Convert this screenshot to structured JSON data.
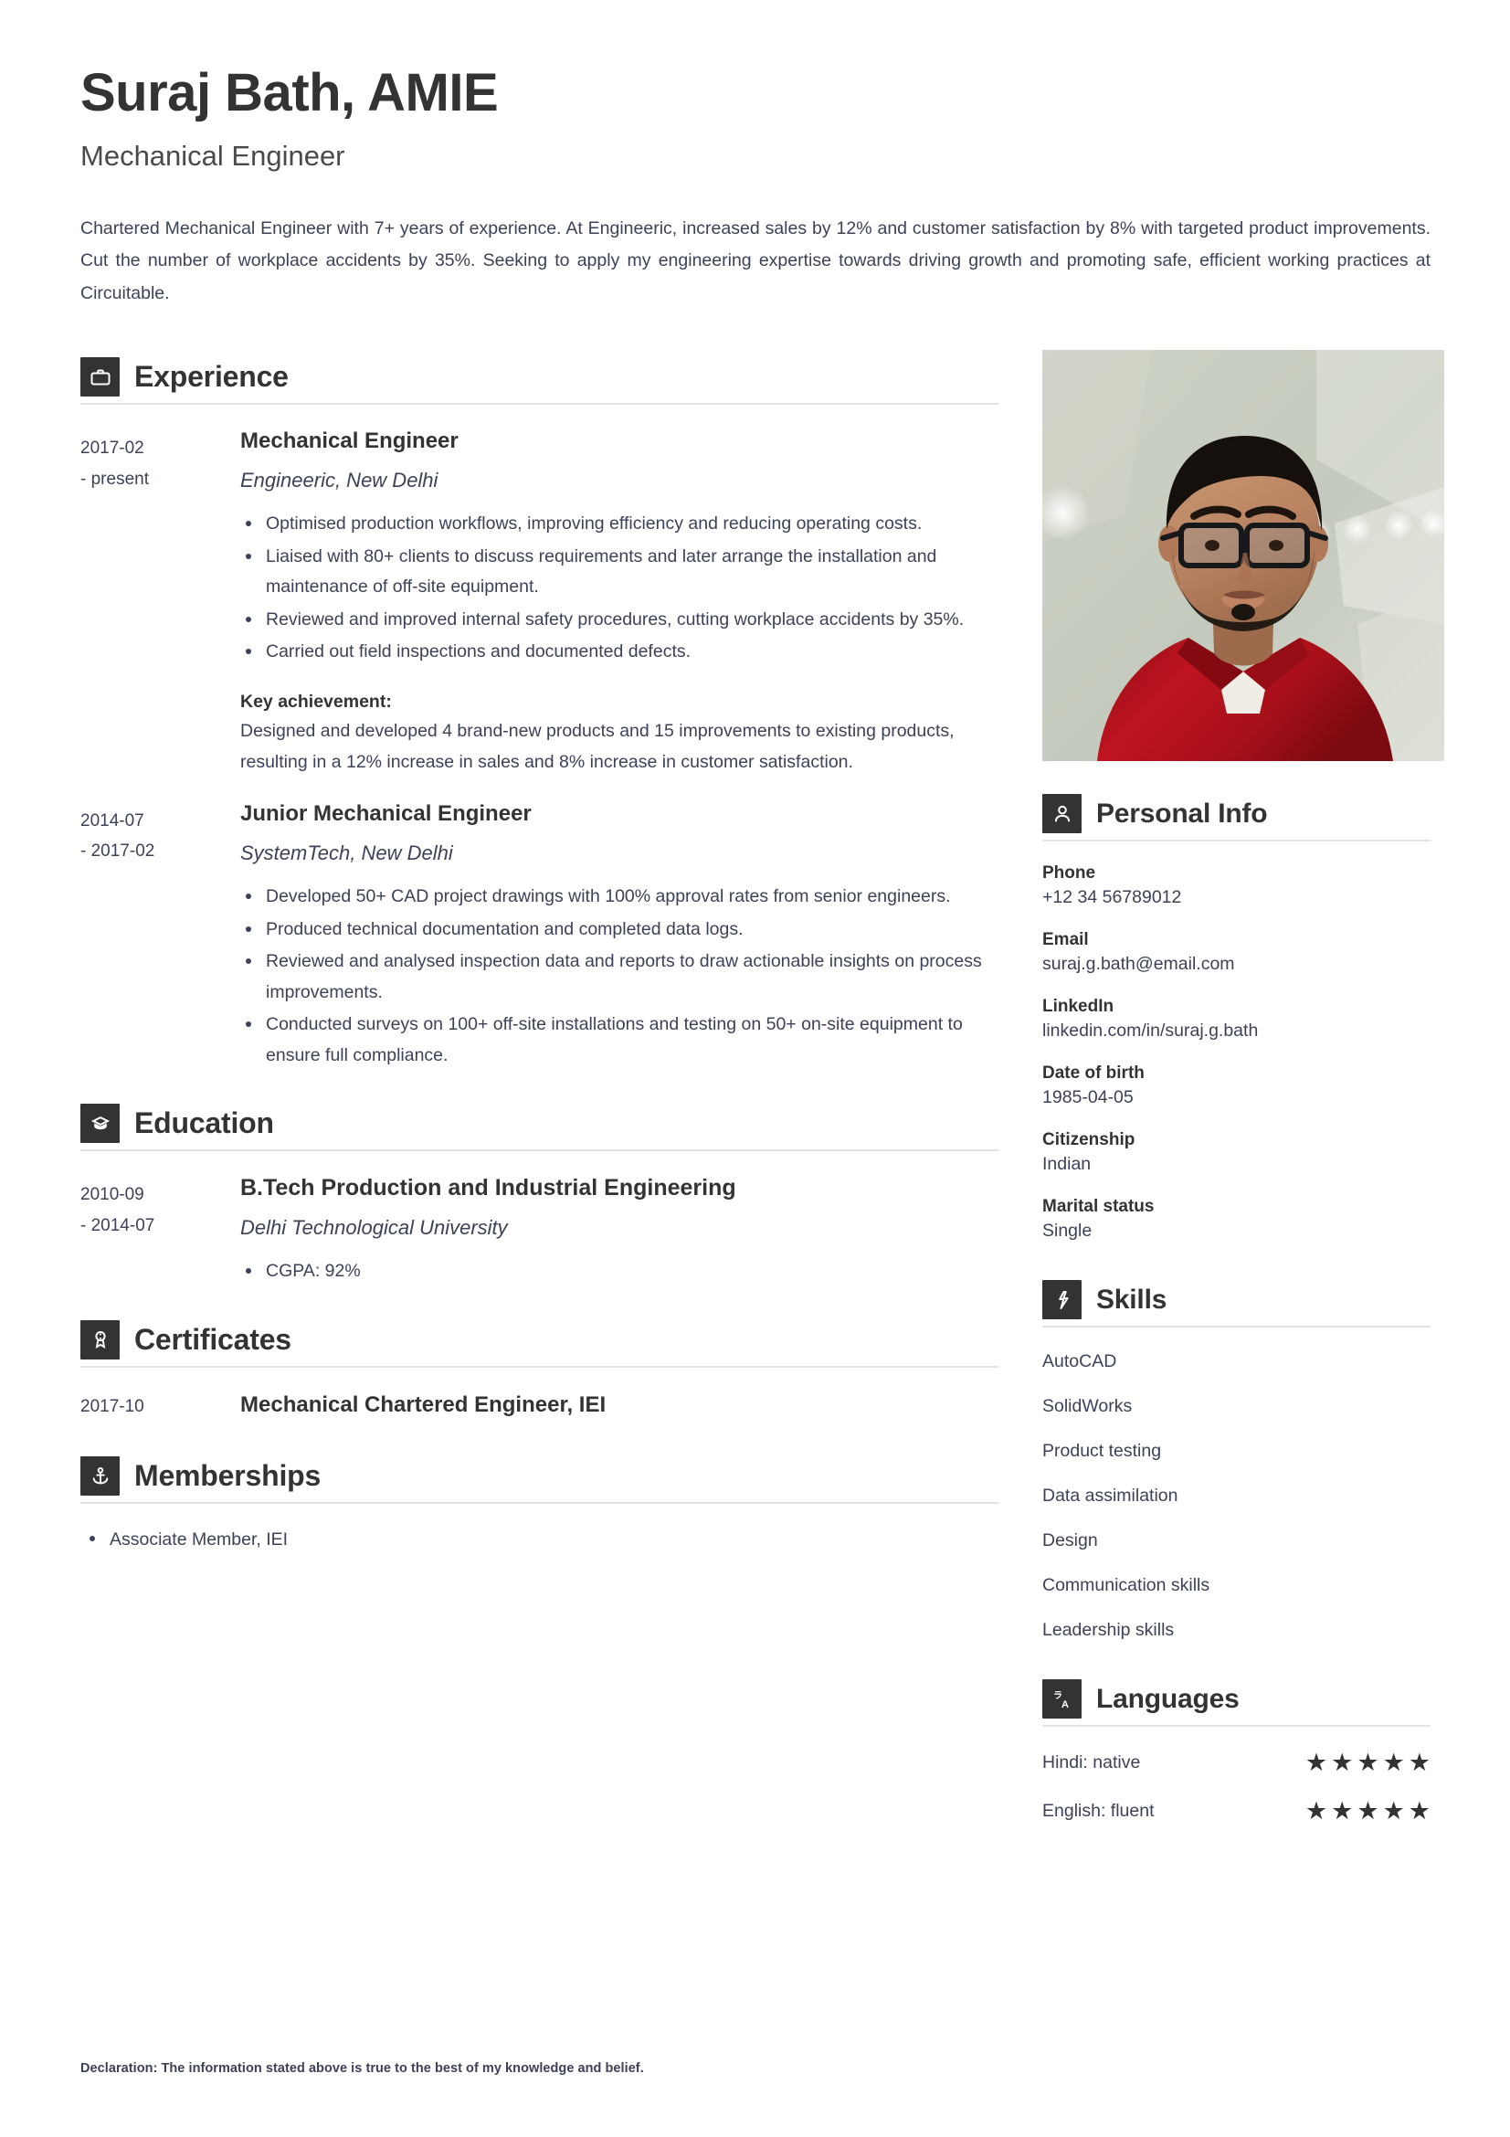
{
  "header": {
    "name": "Suraj Bath, AMIE",
    "job_title": "Mechanical Engineer",
    "summary": "Chartered Mechanical Engineer with 7+ years of experience. At Engineeric, increased sales by 12% and customer satisfaction by 8% with targeted product improvements. Cut the number of workplace accidents by 35%. Seeking to apply my engineering expertise towards driving growth and promoting safe, efficient working practices at Circuitable."
  },
  "sections": {
    "experience": {
      "title": "Experience",
      "icon": "briefcase-icon"
    },
    "education": {
      "title": "Education",
      "icon": "graduation-cap-icon"
    },
    "certificates": {
      "title": "Certificates",
      "icon": "award-ribbon-icon"
    },
    "memberships": {
      "title": "Memberships",
      "icon": "anchor-icon"
    },
    "personal_info": {
      "title": "Personal Info",
      "icon": "person-icon"
    },
    "skills": {
      "title": "Skills",
      "icon": "lightning-bolt-icon"
    },
    "languages": {
      "title": "Languages",
      "icon": "translate-icon"
    }
  },
  "experience": [
    {
      "date_start": "2017-02",
      "date_end": "- present",
      "role": "Mechanical Engineer",
      "company": "Engineeric, New Delhi",
      "bullets": [
        "Optimised production workflows, improving efficiency and reducing operating costs.",
        "Liaised with 80+ clients to discuss requirements and later arrange the installation and maintenance of off-site equipment.",
        "Reviewed and improved internal safety procedures, cutting workplace accidents by 35%.",
        "Carried out field inspections and documented defects."
      ],
      "key_achievement_label": "Key achievement:",
      "key_achievement": "Designed and developed 4 brand-new products and 15 improvements to existing products, resulting in a 12% increase in sales and 8% increase in customer satisfaction."
    },
    {
      "date_start": "2014-07",
      "date_end": "- 2017-02",
      "role": "Junior Mechanical Engineer",
      "company": "SystemTech, New Delhi",
      "bullets": [
        "Developed 50+ CAD project drawings with 100% approval rates from senior engineers.",
        "Produced technical documentation and completed data logs.",
        "Reviewed and analysed inspection data and reports to draw actionable insights on process improvements.",
        "Conducted surveys on 100+ off-site installations and testing on 50+ on-site equipment to ensure full compliance."
      ]
    }
  ],
  "education": [
    {
      "date_start": "2010-09",
      "date_end": "- 2014-07",
      "degree": "B.Tech Production and Industrial Engineering",
      "school": "Delhi Technological University",
      "bullets": [
        "CGPA: 92%"
      ]
    }
  ],
  "certificates": [
    {
      "date": "2017-10",
      "name": "Mechanical Chartered Engineer, IEI"
    }
  ],
  "memberships": [
    "Associate Member, IEI"
  ],
  "personal_info": [
    {
      "label": "Phone",
      "value": "+12 34 56789012"
    },
    {
      "label": "Email",
      "value": "suraj.g.bath@email.com"
    },
    {
      "label": "LinkedIn",
      "value": "linkedin.com/in/suraj.g.bath"
    },
    {
      "label": "Date of birth",
      "value": "1985-04-05"
    },
    {
      "label": "Citizenship",
      "value": "Indian"
    },
    {
      "label": "Marital status",
      "value": "Single"
    }
  ],
  "skills": [
    "AutoCAD",
    "SolidWorks",
    "Product testing",
    "Data assimilation",
    "Design",
    "Communication skills",
    "Leadership skills"
  ],
  "languages": [
    {
      "name": "Hindi: native",
      "rating": 5,
      "max": 5
    },
    {
      "name": "English: fluent",
      "rating": 5,
      "max": 5
    }
  ],
  "declaration": "Declaration: The information stated above is true to the best of my knowledge and belief.",
  "photo": {
    "alt": "portrait-photo",
    "background_color": "#c9cec2",
    "shirt_color": "#b4121c",
    "hair_color": "#1a1410",
    "skin_color": "#b98a63"
  },
  "colors": {
    "heading": "#333333",
    "body_text": "#3c4257",
    "icon_box": "#333333",
    "rule": "#e2e2e2"
  }
}
